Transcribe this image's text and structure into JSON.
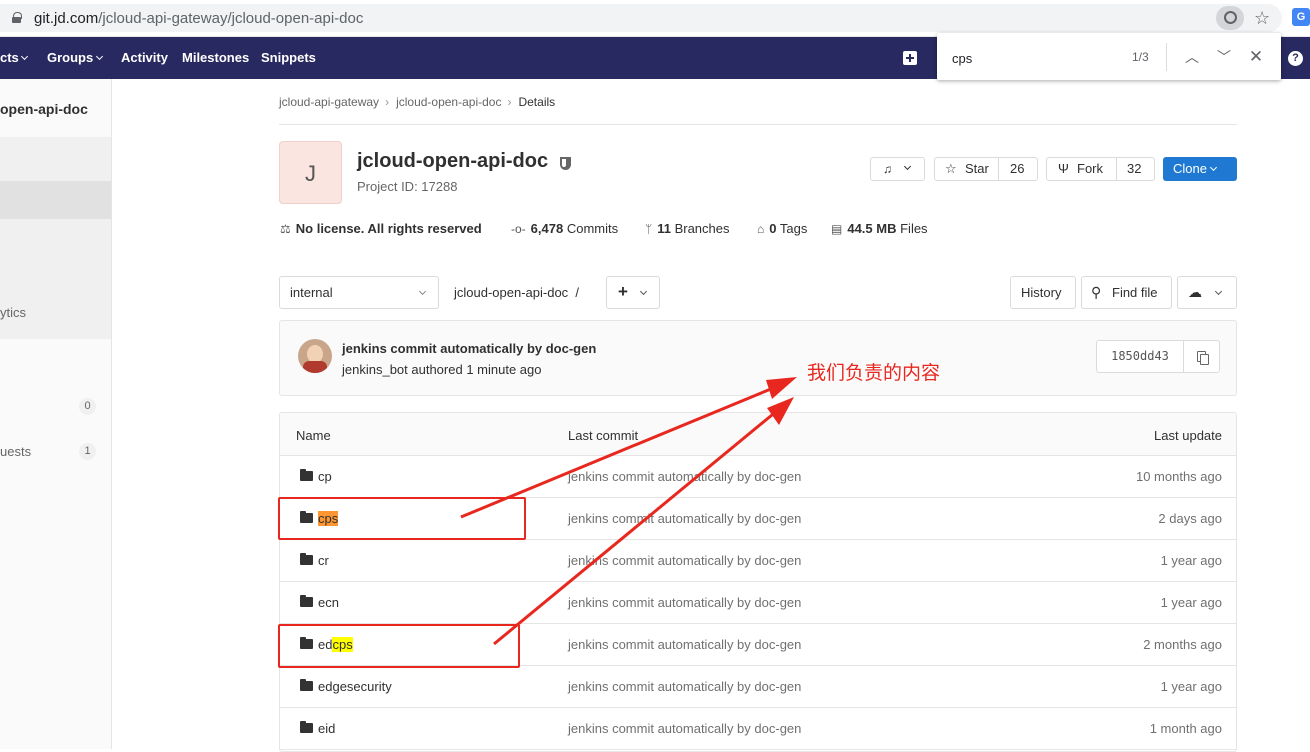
{
  "browser": {
    "url_host": "git.jd.com",
    "url_path": "/jcloud-api-gateway/jcloud-open-api-doc"
  },
  "topnav": {
    "items": [
      "cts",
      "Groups",
      "Activity",
      "Milestones",
      "Snippets"
    ]
  },
  "findbar": {
    "query": "cps",
    "count": "1/3"
  },
  "sidebar": {
    "title": "open-api-doc",
    "analytics_label": "ytics",
    "issues_count": "0",
    "merge_requests_label": "uests",
    "merge_requests_count": "1"
  },
  "breadcrumbs": [
    "jcloud-api-gateway",
    "jcloud-open-api-doc",
    "Details"
  ],
  "project": {
    "avatar_letter": "J",
    "name": "jcloud-open-api-doc",
    "id_label": "Project ID: 17288",
    "star_label": "Star",
    "star_count": "26",
    "fork_label": "Fork",
    "fork_count": "32",
    "clone_label": "Clone"
  },
  "stats": {
    "license": "No license. All rights reserved",
    "commits_num": "6,478",
    "commits_label": "Commits",
    "branches_num": "11",
    "branches_label": "Branches",
    "tags_num": "0",
    "tags_label": "Tags",
    "files_size": "44.5 MB",
    "files_label": "Files"
  },
  "tree": {
    "branch": "internal",
    "path": "jcloud-open-api-doc",
    "path_sep": "/",
    "history_label": "History",
    "find_file_label": "Find file"
  },
  "last_commit": {
    "title": "jenkins commit automatically by doc-gen",
    "author": "jenkins_bot authored 1 minute ago",
    "sha": "1850dd43"
  },
  "files": {
    "headers": {
      "name": "Name",
      "last_commit": "Last commit",
      "last_update": "Last update"
    },
    "rows": [
      {
        "name": "cp",
        "commit": "jenkins commit automatically by doc-gen",
        "updated": "10 months ago"
      },
      {
        "name": "cps",
        "commit": "jenkins commit automatically by doc-gen",
        "updated": "2 days ago"
      },
      {
        "name": "cr",
        "commit": "jenkins commit automatically by doc-gen",
        "updated": "1 year ago"
      },
      {
        "name": "ecn",
        "commit": "jenkins commit automatically by doc-gen",
        "updated": "1 year ago"
      },
      {
        "name_prefix": "ed",
        "name_match": "cps",
        "commit": "jenkins commit automatically by doc-gen",
        "updated": "2 months ago"
      },
      {
        "name": "edgesecurity",
        "commit": "jenkins commit automatically by doc-gen",
        "updated": "1 year ago"
      },
      {
        "name": "eid",
        "commit": "jenkins commit automatically by doc-gen",
        "updated": "1 month ago"
      }
    ]
  },
  "annotation": {
    "text": "我们负责的内容",
    "color": "#e8281f"
  },
  "colors": {
    "nav_bg": "#292961",
    "clone_blue": "#1f78d1",
    "find_active": "#ff9632",
    "find_match": "#ffff00"
  }
}
